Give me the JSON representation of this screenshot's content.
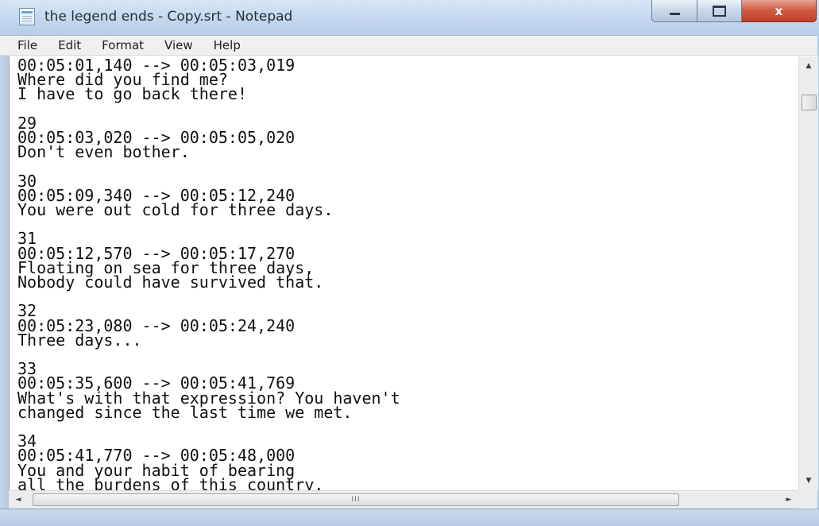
{
  "window": {
    "title": "the legend ends - Copy.srt - Notepad",
    "app_icon": "notepad-icon",
    "caption_buttons": {
      "minimize_icon": "minimize-icon",
      "maximize_icon": "maximize-icon",
      "close_icon": "close-icon",
      "close_glyph": "x"
    }
  },
  "menu": {
    "items": [
      {
        "label": "File"
      },
      {
        "label": "Edit"
      },
      {
        "label": "Format"
      },
      {
        "label": "View"
      },
      {
        "label": "Help"
      }
    ]
  },
  "editor": {
    "lines": [
      "00:05:01,140 --> 00:05:03,019",
      "Where did you find me?",
      "I have to go back there!",
      "",
      "29",
      "00:05:03,020 --> 00:05:05,020",
      "Don't even bother.",
      "",
      "30",
      "00:05:09,340 --> 00:05:12,240",
      "You were out cold for three days.",
      "",
      "31",
      "00:05:12,570 --> 00:05:17,270",
      "Floating on sea for three days,",
      "Nobody could have survived that.",
      "",
      "32",
      "00:05:23,080 --> 00:05:24,240",
      "Three days...",
      "",
      "33",
      "00:05:35,600 --> 00:05:41,769",
      "What's with that expression? You haven't",
      "changed since the last time we met.",
      "",
      "34",
      "00:05:41,770 --> 00:05:48,000",
      "You and your habit of bearing",
      "all the burdens of this country."
    ]
  },
  "scrollbars": {
    "vertical": {
      "up_icon": "scroll-up-arrow-icon",
      "down_icon": "scroll-down-arrow-icon",
      "up_glyph": "▲",
      "down_glyph": "▼"
    },
    "horizontal": {
      "left_icon": "scroll-left-arrow-icon",
      "right_icon": "scroll-right-arrow-icon",
      "left_glyph": "◄",
      "right_glyph": "►",
      "thumb_grip": "III"
    }
  }
}
